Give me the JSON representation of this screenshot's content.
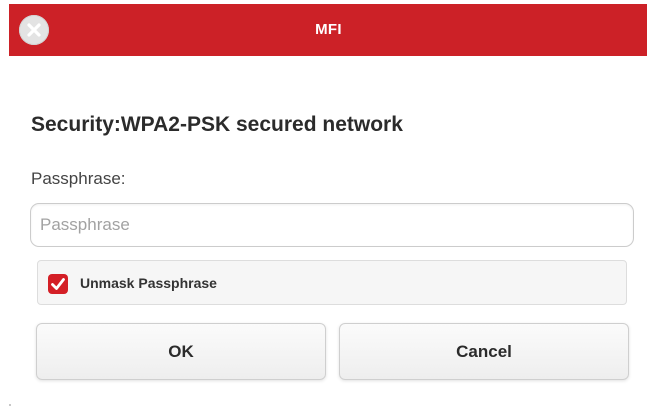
{
  "dialog": {
    "title": "MFI",
    "heading": "Security:WPA2-PSK secured network",
    "passphrase_label": "Passphrase:",
    "passphrase_placeholder": "Passphrase",
    "passphrase_value": "",
    "unmask_label": "Unmask Passphrase",
    "unmask_checked": true,
    "ok_label": "OK",
    "cancel_label": "Cancel"
  },
  "icons": {
    "close": "close-circle-icon",
    "checkbox": "checkmark-icon"
  },
  "colors": {
    "titlebar": "#cc2127",
    "checkbox": "#d41f26",
    "heading_text": "#2b2b2b",
    "placeholder_text": "#a2a2a2",
    "checkbox_row_bg": "#f6f6f6"
  }
}
